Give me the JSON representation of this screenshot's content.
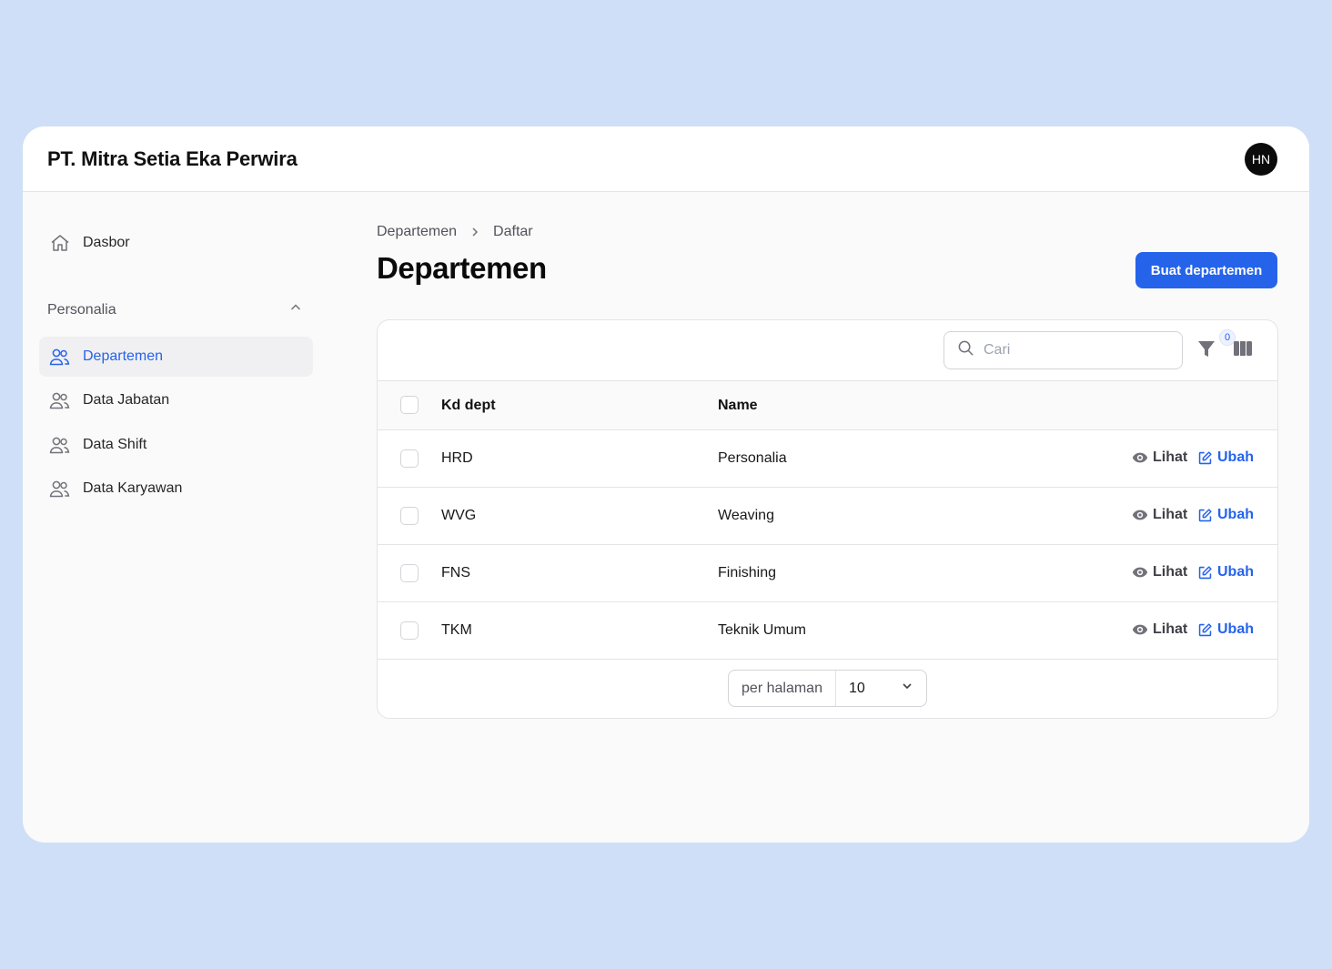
{
  "app": {
    "company": "PT. Mitra Setia Eka Perwira",
    "avatar_initials": "HN"
  },
  "sidebar": {
    "dashboard": {
      "label": "Dasbor",
      "icon": "home-icon"
    },
    "group": {
      "label": "Personalia",
      "icon": "chevron-up-icon",
      "expanded": true
    },
    "items": [
      {
        "label": "Departemen",
        "icon": "users-icon",
        "active": true
      },
      {
        "label": "Data Jabatan",
        "icon": "users-icon",
        "active": false
      },
      {
        "label": "Data Shift",
        "icon": "users-icon",
        "active": false
      },
      {
        "label": "Data Karyawan",
        "icon": "users-icon",
        "active": false
      }
    ]
  },
  "breadcrumb": {
    "items": [
      "Departemen",
      "Daftar"
    ]
  },
  "page": {
    "title": "Departemen",
    "create_button": "Buat departemen"
  },
  "table": {
    "search": {
      "placeholder": "Cari",
      "value": ""
    },
    "filter_count": "0",
    "columns": [
      "Kd dept",
      "Name"
    ],
    "rows": [
      {
        "code": "HRD",
        "name": "Personalia"
      },
      {
        "code": "WVG",
        "name": "Weaving"
      },
      {
        "code": "FNS",
        "name": "Finishing"
      },
      {
        "code": "TKM",
        "name": "Teknik Umum"
      }
    ],
    "actions": {
      "view": "Lihat",
      "edit": "Ubah"
    },
    "pagination": {
      "per_page_label": "per halaman",
      "per_page_value": "10"
    }
  },
  "colors": {
    "accent": "#2563eb",
    "background": "#cfdff7"
  }
}
